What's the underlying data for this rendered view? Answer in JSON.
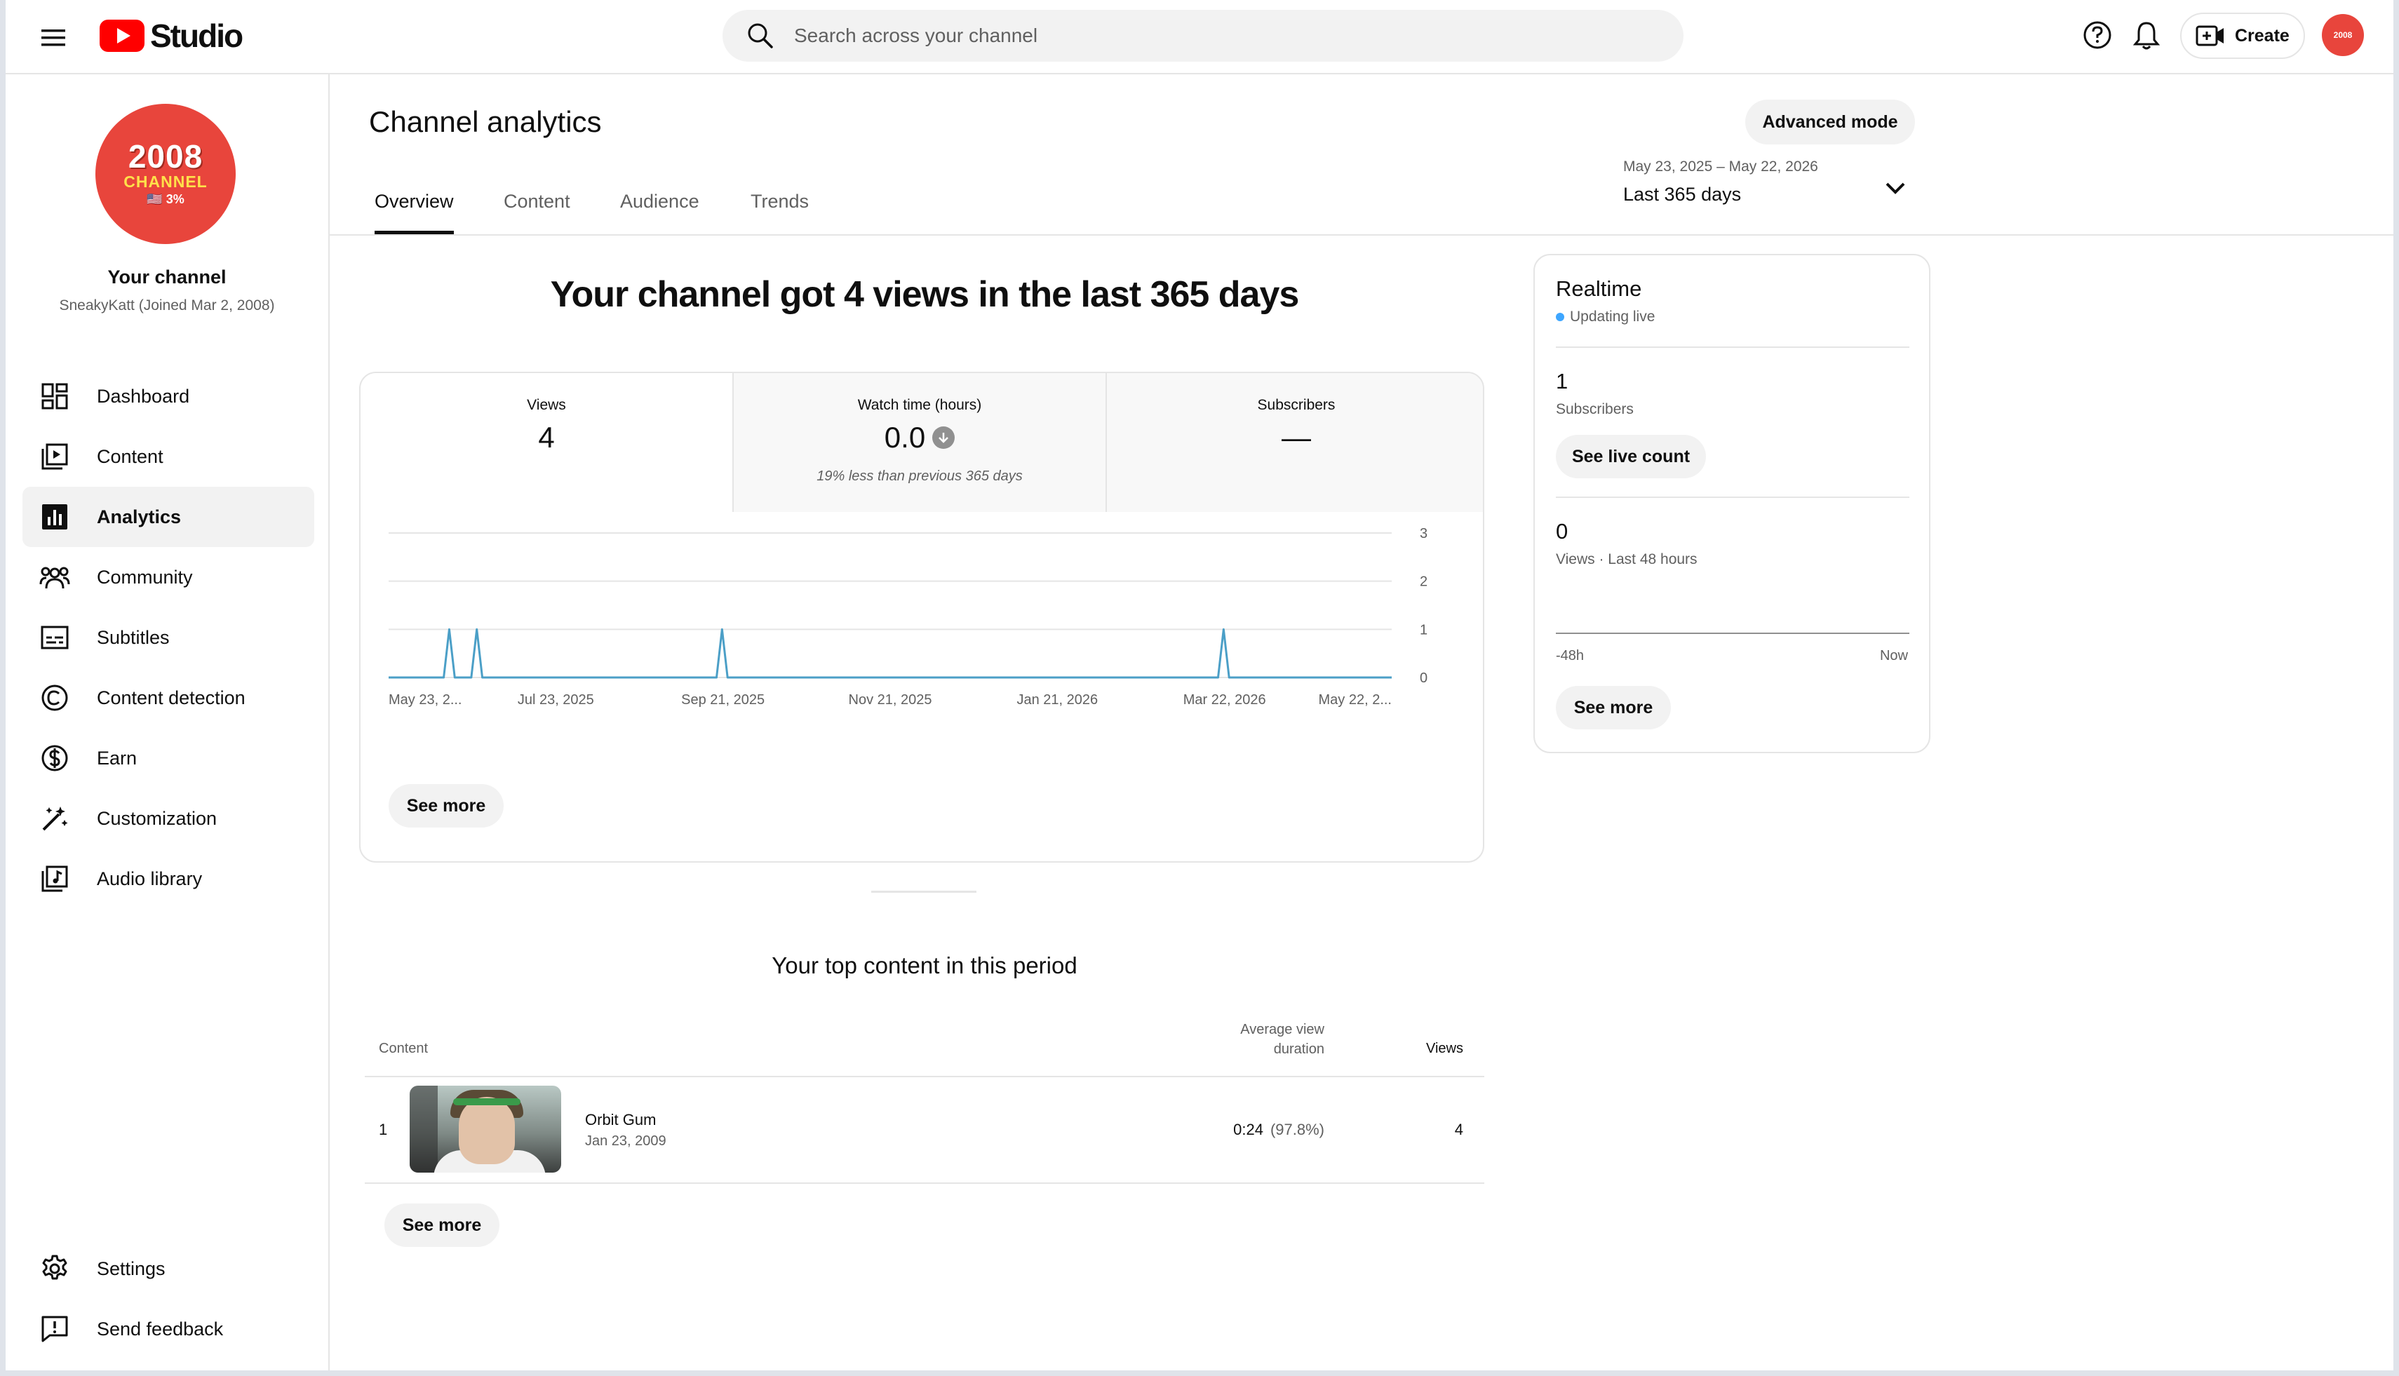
{
  "header": {
    "logo_text": "Studio",
    "search_placeholder": "Search across your channel",
    "create_label": "Create",
    "avatar_text": "2008"
  },
  "sidebar": {
    "channel_avatar": {
      "line1": "2008",
      "line2": "CHANNEL",
      "line3": "🇺🇸 3%"
    },
    "channel_name": "Your channel",
    "channel_sub": "SneakyKatt (Joined Mar 2, 2008)",
    "items": [
      {
        "label": "Dashboard",
        "icon": "dashboard-icon"
      },
      {
        "label": "Content",
        "icon": "content-icon"
      },
      {
        "label": "Analytics",
        "icon": "analytics-icon",
        "active": true
      },
      {
        "label": "Community",
        "icon": "community-icon"
      },
      {
        "label": "Subtitles",
        "icon": "subtitles-icon"
      },
      {
        "label": "Content detection",
        "icon": "copyright-icon"
      },
      {
        "label": "Earn",
        "icon": "dollar-icon"
      },
      {
        "label": "Customization",
        "icon": "magic-wand-icon"
      },
      {
        "label": "Audio library",
        "icon": "audio-library-icon"
      }
    ],
    "bottom_items": [
      {
        "label": "Settings",
        "icon": "gear-icon"
      },
      {
        "label": "Send feedback",
        "icon": "feedback-icon"
      }
    ]
  },
  "main": {
    "title": "Channel analytics",
    "advanced_mode": "Advanced mode",
    "tabs": [
      "Overview",
      "Content",
      "Audience",
      "Trends"
    ],
    "date_range": {
      "range": "May 23, 2025 – May 22, 2026",
      "label": "Last 365 days"
    },
    "headline": "Your channel got 4 views in the last 365 days",
    "metrics": [
      {
        "label": "Views",
        "value": "4",
        "note": ""
      },
      {
        "label": "Watch time (hours)",
        "value": "0.0",
        "note": "19% less than previous 365 days"
      },
      {
        "label": "Subscribers",
        "value": "—",
        "note": ""
      }
    ],
    "chart_see_more": "See more",
    "top_content_title": "Your top content in this period",
    "table": {
      "col_content": "Content",
      "col_avg_line1": "Average view",
      "col_avg_line2": "duration",
      "col_views": "Views",
      "rows": [
        {
          "rank": "1",
          "title": "Orbit Gum",
          "date": "Jan 23, 2009",
          "avg": "0:24",
          "avg_pct": "(97.8%)",
          "views": "4"
        }
      ]
    },
    "table_see_more": "See more"
  },
  "realtime": {
    "title": "Realtime",
    "status": "Updating live",
    "subs_value": "1",
    "subs_label": "Subscribers",
    "see_live_count": "See live count",
    "views_value": "0",
    "views_label": "Views · Last 48 hours",
    "axis_start": "-48h",
    "axis_end": "Now",
    "see_more": "See more"
  },
  "chart_data": {
    "type": "line",
    "x_tick_labels": [
      "May 23, 2...",
      "Jul 23, 2025",
      "Sep 21, 2025",
      "Nov 21, 2025",
      "Jan 21, 2026",
      "Mar 22, 2026",
      "May 22, 2..."
    ],
    "y_ticks": [
      0,
      1,
      2,
      3
    ],
    "ylim": [
      0,
      3
    ],
    "x_start": "2025-05-23",
    "x_end": "2026-05-22",
    "series": [
      {
        "color": "#4b9fc7",
        "points": [
          {
            "date": "2025-06-14",
            "value": 1
          },
          {
            "date": "2025-06-24",
            "value": 1
          },
          {
            "date": "2025-09-21",
            "value": 1
          },
          {
            "date": "2026-03-22",
            "value": 1
          }
        ]
      }
    ],
    "grid": true
  }
}
